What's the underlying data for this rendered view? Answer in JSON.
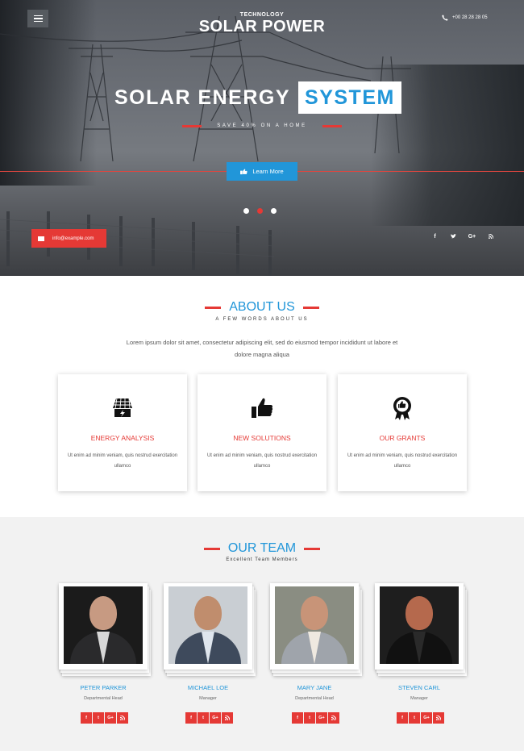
{
  "header": {
    "brand_top": "TECHNOLOGY",
    "brand_main": "SOLAR POWER",
    "phone": "+00 28 28 28 05"
  },
  "hero": {
    "headline_1": "SOLAR ENERGY",
    "headline_2": "SYSTEM",
    "tagline": "SAVE 40% ON A HOME",
    "cta_label": "Learn More",
    "slide_count": 3,
    "active_slide": 2,
    "email": "info@example.com",
    "social": [
      "f",
      "t",
      "G+",
      "rss"
    ]
  },
  "about": {
    "title": "ABOUT US",
    "subtitle": "A FEW WORDS ABOUT US",
    "text": "Lorem ipsum dolor sit amet, consectetur adipiscing elit, sed do eiusmod tempor incididunt ut labore et dolore magna aliqua",
    "cards": [
      {
        "icon": "solar-panel-icon",
        "title": "ENERGY ANALYSIS",
        "text": "Ut enim ad minim veniam, quis nostrud exercitation ullamco"
      },
      {
        "icon": "thumbs-up-icon",
        "title": "NEW SOLUTIONS",
        "text": "Ut enim ad minim veniam, quis nostrud exercitation ullamco"
      },
      {
        "icon": "award-badge-icon",
        "title": "OUR GRANTS",
        "text": "Ut enim ad minim veniam, quis nostrud exercitation ullamco"
      }
    ]
  },
  "team": {
    "title": "OUR TEAM",
    "subtitle": "Excellent Team Members",
    "members": [
      {
        "name": "PETER PARKER",
        "role": "Departmental Head"
      },
      {
        "name": "MICHAEL LOE",
        "role": "Manager"
      },
      {
        "name": "MARY JANE",
        "role": "Departmental Head"
      },
      {
        "name": "STEVEN CARL",
        "role": "Manager"
      }
    ],
    "social": [
      "f",
      "t",
      "G+",
      "rss"
    ]
  },
  "colors": {
    "accent_blue": "#2196d9",
    "accent_red": "#e53935"
  }
}
